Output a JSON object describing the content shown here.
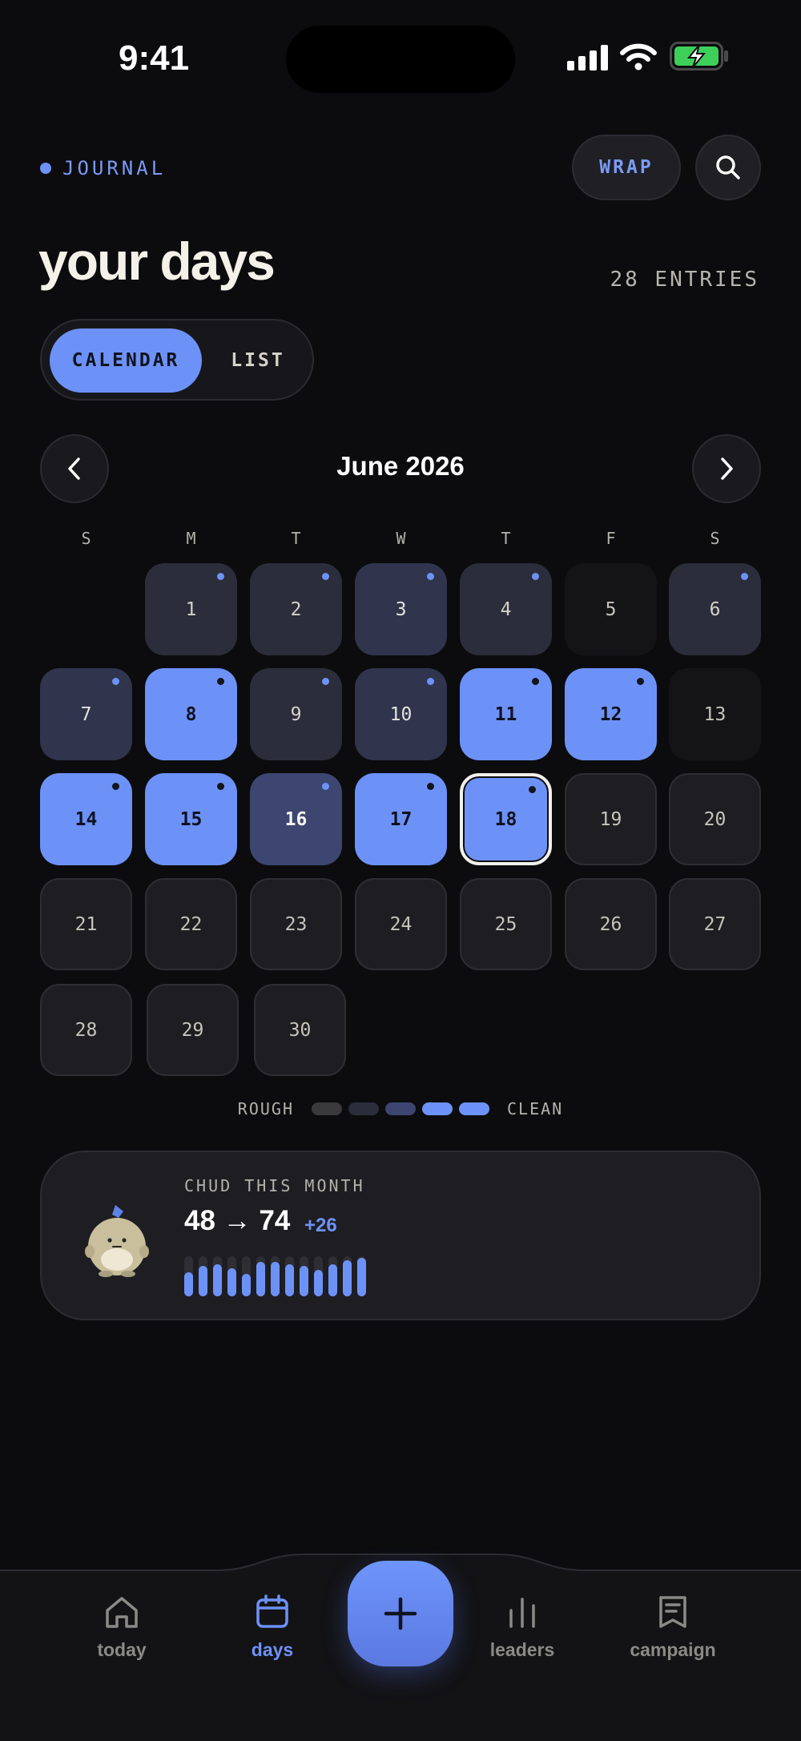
{
  "status_bar": {
    "time": "9:41"
  },
  "header": {
    "section_label": "JOURNAL",
    "wrap_label": "WRAP",
    "title": "your days",
    "entries_count": "28 ENTRIES"
  },
  "view_toggle": {
    "options": [
      "CALENDAR",
      "LIST"
    ],
    "selected": "CALENDAR"
  },
  "calendar": {
    "month_label": "June 2026",
    "weekdays": [
      "S",
      "M",
      "T",
      "W",
      "T",
      "F",
      "S"
    ],
    "selected_day": 18,
    "days": [
      {
        "d": "1",
        "level": 1,
        "mark": "blue"
      },
      {
        "d": "2",
        "level": 1,
        "mark": "blue"
      },
      {
        "d": "3",
        "level": 2,
        "mark": "blue"
      },
      {
        "d": "4",
        "level": 1,
        "mark": "blue"
      },
      {
        "d": "5",
        "level": 0,
        "mark": ""
      },
      {
        "d": "6",
        "level": 1,
        "mark": "blue"
      },
      {
        "d": "7",
        "level": 2,
        "mark": "blue"
      },
      {
        "d": "8",
        "level": 4,
        "mark": "dark"
      },
      {
        "d": "9",
        "level": 1,
        "mark": "blue"
      },
      {
        "d": "10",
        "level": 2,
        "mark": "blue"
      },
      {
        "d": "11",
        "level": 4,
        "mark": "dark"
      },
      {
        "d": "12",
        "level": 4,
        "mark": "dark"
      },
      {
        "d": "13",
        "level": 0,
        "mark": ""
      },
      {
        "d": "14",
        "level": 4,
        "mark": "dark"
      },
      {
        "d": "15",
        "level": 4,
        "mark": "dark"
      },
      {
        "d": "16",
        "level": 3,
        "mark": "blue"
      },
      {
        "d": "17",
        "level": 4,
        "mark": "dark"
      },
      {
        "d": "18",
        "level": 4,
        "mark": "dark"
      },
      {
        "d": "19",
        "level": -1,
        "mark": ""
      },
      {
        "d": "20",
        "level": -1,
        "mark": ""
      },
      {
        "d": "21",
        "level": -1,
        "mark": ""
      },
      {
        "d": "22",
        "level": -1,
        "mark": ""
      },
      {
        "d": "23",
        "level": -1,
        "mark": ""
      },
      {
        "d": "24",
        "level": -1,
        "mark": ""
      },
      {
        "d": "25",
        "level": -1,
        "mark": ""
      },
      {
        "d": "26",
        "level": -1,
        "mark": ""
      },
      {
        "d": "27",
        "level": -1,
        "mark": ""
      },
      {
        "d": "28",
        "level": -1,
        "mark": ""
      },
      {
        "d": "29",
        "level": -1,
        "mark": ""
      },
      {
        "d": "30",
        "level": -1,
        "mark": ""
      }
    ],
    "legend": {
      "low_label": "ROUGH",
      "high_label": "CLEAN",
      "swatches": [
        "#3a3a3c",
        "#2b2d3a",
        "#3c4670",
        "#6d92f7",
        "#6d92f7"
      ]
    }
  },
  "chud_card": {
    "label": "CHUD THIS MONTH",
    "value": "48 → 74",
    "delta": "+26",
    "bar_levels": [
      0.6,
      0.75,
      0.8,
      0.7,
      0.55,
      0.85,
      0.85,
      0.8,
      0.75,
      0.65,
      0.8,
      0.9,
      0.95
    ]
  },
  "tab_bar": {
    "tabs": [
      {
        "label": "today",
        "icon": "home-icon"
      },
      {
        "label": "days",
        "icon": "calendar-icon"
      },
      {
        "label": "leaders",
        "icon": "bar-chart-icon"
      },
      {
        "label": "campaign",
        "icon": "receipt-icon"
      }
    ],
    "active": "days",
    "fab_icon": "plus-icon"
  },
  "colors": {
    "accent": "#6d92f7",
    "background": "#0c0c0e",
    "card": "#1e1e22"
  }
}
